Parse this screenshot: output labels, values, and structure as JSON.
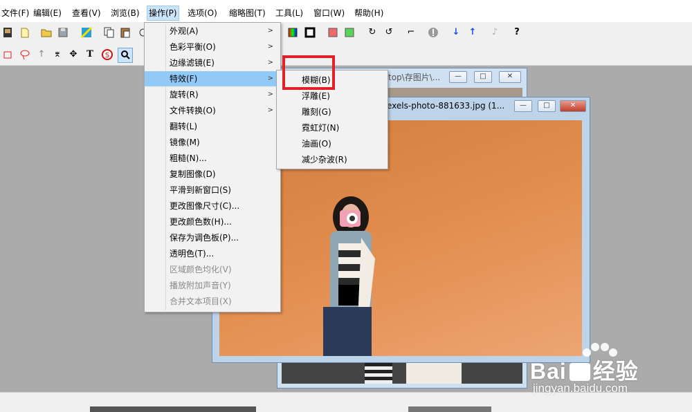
{
  "menubar": {
    "items": [
      {
        "label": "文件(F)"
      },
      {
        "label": "编辑(E)"
      },
      {
        "label": "查看(V)"
      },
      {
        "label": "浏览(B)"
      },
      {
        "label": "操作(P)"
      },
      {
        "label": "选项(O)"
      },
      {
        "label": "缩略图(T)"
      },
      {
        "label": "工具(L)"
      },
      {
        "label": "窗口(W)"
      },
      {
        "label": "帮助(H)"
      }
    ]
  },
  "operation_menu": {
    "items": [
      {
        "label": "外观(A)",
        "submenu": true,
        "enabled": true
      },
      {
        "label": "色彩平衡(O)",
        "submenu": true,
        "enabled": true
      },
      {
        "label": "边缘滤镜(E)",
        "submenu": true,
        "enabled": true
      },
      {
        "label": "特效(F)",
        "submenu": true,
        "enabled": true,
        "selected": true
      },
      {
        "label": "旋转(R)",
        "submenu": true,
        "enabled": true
      },
      {
        "label": "文件转换(O)",
        "submenu": true,
        "enabled": true
      },
      {
        "label": "翻转(L)",
        "submenu": false,
        "enabled": true
      },
      {
        "label": "镜像(M)",
        "submenu": false,
        "enabled": true
      },
      {
        "label": "粗糙(N)...",
        "submenu": false,
        "enabled": true
      },
      {
        "label": "复制图像(D)",
        "submenu": false,
        "enabled": true
      },
      {
        "label": "平滑到新窗口(S)",
        "submenu": false,
        "enabled": true
      },
      {
        "label": "更改图像尺寸(C)...",
        "submenu": false,
        "enabled": true
      },
      {
        "label": "更改颜色数(H)...",
        "submenu": false,
        "enabled": true
      },
      {
        "label": "保存为调色板(P)...",
        "submenu": false,
        "enabled": true
      },
      {
        "label": "透明色(T)...",
        "submenu": false,
        "enabled": true
      },
      {
        "label": "区域颜色均化(V)",
        "submenu": false,
        "enabled": false
      },
      {
        "label": "播放附加声音(Y)",
        "submenu": false,
        "enabled": false
      },
      {
        "label": "合并文本项目(X)",
        "submenu": false,
        "enabled": false
      }
    ]
  },
  "effects_submenu": {
    "items": [
      {
        "label": "模糊(B)",
        "highlighted": true
      },
      {
        "label": "浮雕(E)"
      },
      {
        "label": "雕刻(G)"
      },
      {
        "label": "霓虹灯(N)"
      },
      {
        "label": "油画(O)"
      },
      {
        "label": "减少杂波(R)"
      }
    ]
  },
  "back_window": {
    "title": "top\\存图片\\..."
  },
  "front_window": {
    "title": "exels-photo-881633.jpg (1..."
  },
  "window_buttons": {
    "minimize": "—",
    "maximize": "□",
    "close": "✕"
  },
  "watermark": {
    "brand": "Bai",
    "brand2": "经验",
    "url": "jingyan.baidu.com"
  },
  "colors": {
    "highlight_box": "#e0202a",
    "menu_selected": "#91c9f7",
    "photo_orange": "#e0894a",
    "baidu_blue": "#2d5bd0"
  }
}
